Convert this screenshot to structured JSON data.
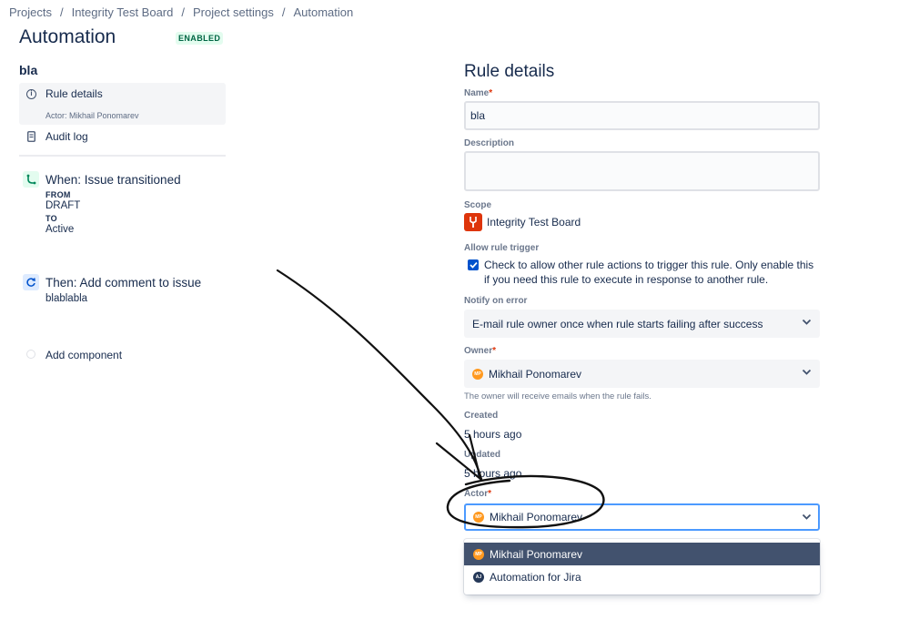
{
  "breadcrumb": [
    "Projects",
    "Integrity Test Board",
    "Project settings",
    "Automation"
  ],
  "header": {
    "title": "Automation",
    "status_badge": "ENABLED"
  },
  "sidebar": {
    "rule_name": "bla",
    "rule_details_label": "Rule details",
    "actor_note": "Actor: Mikhail Ponomarev",
    "audit_log_label": "Audit log"
  },
  "components": {
    "trigger": {
      "title": "When: Issue transitioned",
      "from_label": "FROM",
      "from_value": "DRAFT",
      "to_label": "TO",
      "to_value": "Active"
    },
    "action": {
      "title": "Then: Add comment to issue",
      "text": "blablabla"
    },
    "add_component_label": "Add component"
  },
  "rule_details": {
    "title": "Rule details",
    "name_label": "Name",
    "name_value": "bla",
    "description_label": "Description",
    "description_value": "",
    "scope_label": "Scope",
    "scope_value": "Integrity Test Board",
    "allow_trigger_label": "Allow rule trigger",
    "allow_trigger_checked": true,
    "allow_trigger_text": "Check to allow other rule actions to trigger this rule. Only enable this if you need this rule to execute in response to another rule.",
    "notify_label": "Notify on error",
    "notify_value": "E-mail rule owner once when rule starts failing after success",
    "owner_label": "Owner",
    "owner_value": "Mikhail Ponomarev",
    "owner_initials": "MP",
    "owner_helper": "The owner will receive emails when the rule fails.",
    "created_label": "Created",
    "created_value": "5 hours ago",
    "updated_label": "Updated",
    "updated_value": "5 hours ago",
    "actor_label": "Actor",
    "actor_value": "Mikhail Ponomarev",
    "actor_initials": "MP",
    "actor_options": [
      {
        "label": "Mikhail Ponomarev",
        "initials": "MP",
        "selected": true
      },
      {
        "label": "Automation for Jira",
        "initials": "AJ",
        "selected": false
      }
    ]
  },
  "colors": {
    "accent": "#0052cc",
    "focus": "#4c9aff",
    "avatar_orange": "#ff991f",
    "selected_option": "#42526e",
    "badge_bg": "#e3fcef",
    "badge_fg": "#006644"
  },
  "icons": [
    "info-icon",
    "document-icon",
    "branch-icon",
    "refresh-icon",
    "chevron-down-icon",
    "check-icon",
    "project-icon"
  ]
}
